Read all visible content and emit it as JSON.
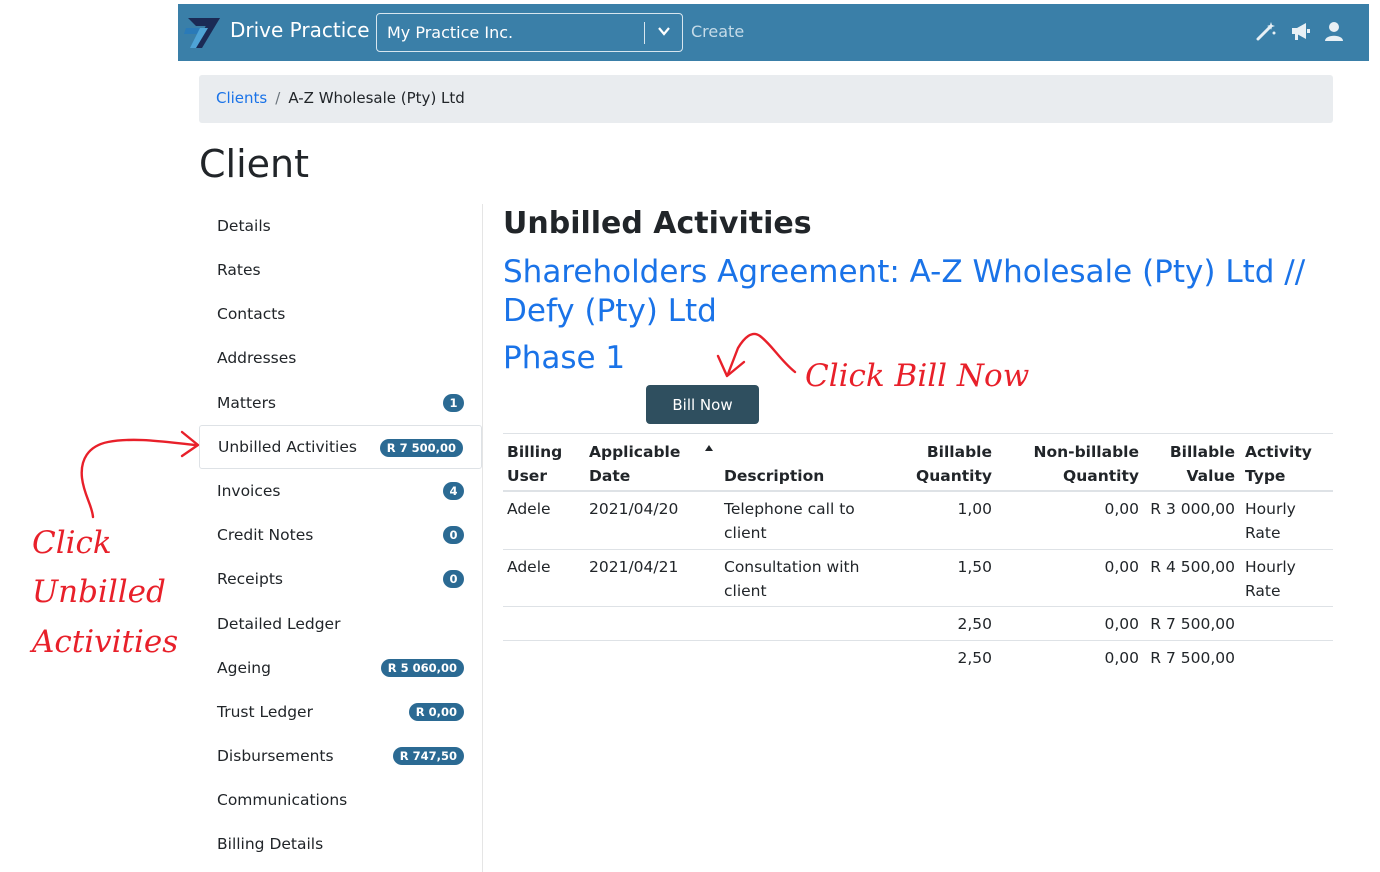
{
  "navbar": {
    "brand": "Drive Practice",
    "practice": "My Practice Inc.",
    "create": "Create",
    "icons": [
      "magic-wand-icon",
      "megaphone-icon",
      "user-icon"
    ]
  },
  "breadcrumb": {
    "clients": "Clients",
    "separator": "/",
    "current": "A-Z Wholesale (Pty) Ltd"
  },
  "page_title": "Client",
  "sidebar": {
    "items": [
      {
        "label": "Details",
        "badge": ""
      },
      {
        "label": "Rates",
        "badge": ""
      },
      {
        "label": "Contacts",
        "badge": ""
      },
      {
        "label": "Addresses",
        "badge": ""
      },
      {
        "label": "Matters",
        "badge": "1"
      },
      {
        "label": "Unbilled Activities",
        "badge": "R 7 500,00"
      },
      {
        "label": "Invoices",
        "badge": "4"
      },
      {
        "label": "Credit Notes",
        "badge": "0"
      },
      {
        "label": "Receipts",
        "badge": "0"
      },
      {
        "label": "Detailed Ledger",
        "badge": ""
      },
      {
        "label": "Ageing",
        "badge": "R 5 060,00"
      },
      {
        "label": "Trust Ledger",
        "badge": "R 0,00"
      },
      {
        "label": "Disbursements",
        "badge": "R 747,50"
      },
      {
        "label": "Communications",
        "badge": ""
      },
      {
        "label": "Billing Details",
        "badge": ""
      }
    ]
  },
  "main": {
    "title": "Unbilled Activities",
    "matter": "Shareholders Agreement: A-Z Wholesale (Pty) Ltd // Defy (Pty) Ltd",
    "phase": "Phase 1",
    "bill_now": "Bill Now"
  },
  "table": {
    "headers": {
      "billing_user_1": "Billing",
      "billing_user_2": "User",
      "applicable_date_1": "Applicable",
      "applicable_date_2": "Date",
      "description": "Description",
      "billable_qty_1": "Billable",
      "billable_qty_2": "Quantity",
      "nonbillable_qty_1": "Non-billable",
      "nonbillable_qty_2": "Quantity",
      "billable_value_1": "Billable",
      "billable_value_2": "Value",
      "activity_type_1": "Activity",
      "activity_type_2": "Type"
    },
    "rows": [
      {
        "user": "Adele",
        "date": "2021/04/20",
        "desc_1": "Telephone call to",
        "desc_2": "client",
        "bq": "1,00",
        "nbq": "0,00",
        "value": "R 3 000,00",
        "type_1": "Hourly",
        "type_2": "Rate"
      },
      {
        "user": "Adele",
        "date": "2021/04/21",
        "desc_1": "Consultation with",
        "desc_2": "client",
        "bq": "1,50",
        "nbq": "0,00",
        "value": "R 4 500,00",
        "type_1": "Hourly",
        "type_2": "Rate"
      }
    ],
    "subtotal": {
      "bq": "2,50",
      "nbq": "0,00",
      "value": "R 7 500,00"
    },
    "total": {
      "bq": "2,50",
      "nbq": "0,00",
      "value": "R 7 500,00"
    }
  },
  "annotations": {
    "bill_now": "Click Bill Now",
    "unbilled_1": "Click",
    "unbilled_2": "Unbilled",
    "unbilled_3": "Activities",
    "color": "#e8202a"
  }
}
